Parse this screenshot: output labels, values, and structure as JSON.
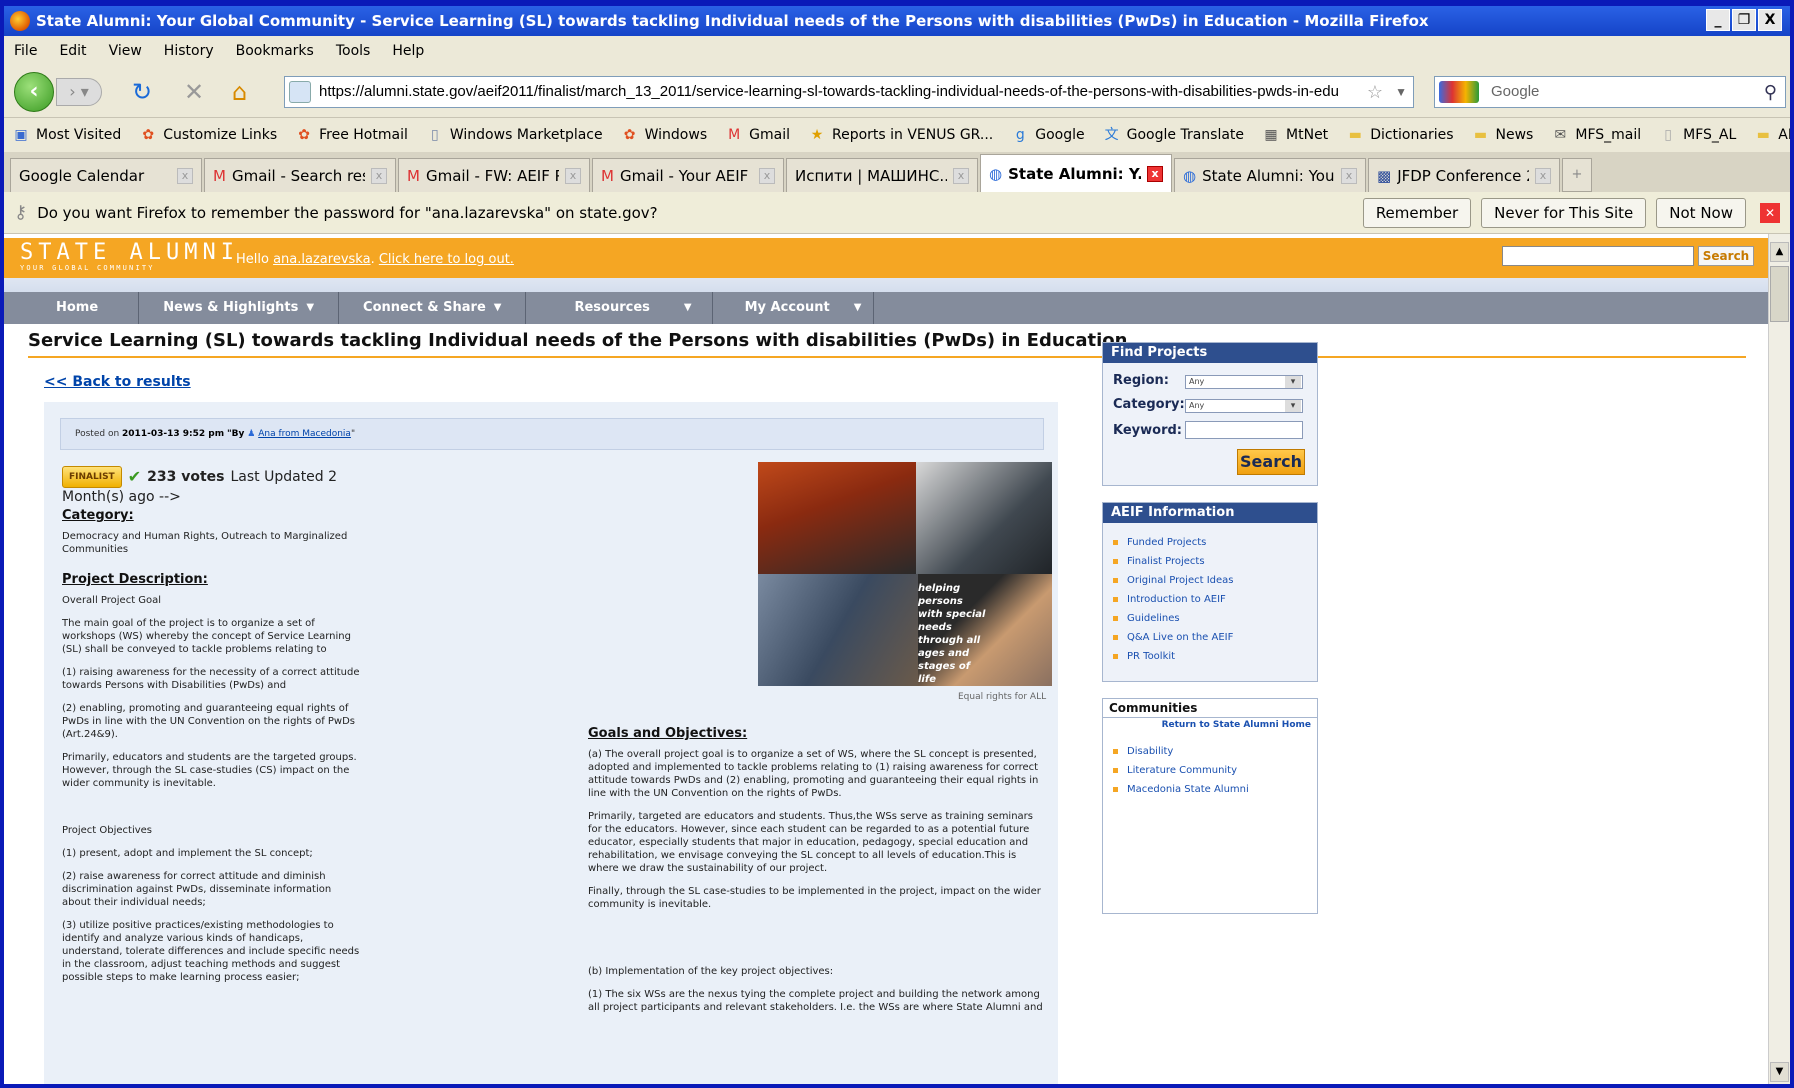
{
  "window": {
    "title": "State Alumni: Your Global Community - Service Learning (SL) towards tackling Individual needs of the Persons with disabilities (PwDs) in Education - Mozilla Firefox",
    "controls": [
      "_",
      "ő",
      "X"
    ]
  },
  "menu": [
    "File",
    "Edit",
    "View",
    "History",
    "Bookmarks",
    "Tools",
    "Help"
  ],
  "nav": {
    "url": "https://alumni.state.gov/aeif2011/finalist/march_13_2011/service-learning-sl-towards-tackling-individual-needs-of-the-persons-with-disabilities-pwds-in-edu",
    "search_placeholder": "Google"
  },
  "bookmarks": [
    "Most Visited",
    "Customize Links",
    "Free Hotmail",
    "Windows Marketplace",
    "Windows",
    "Gmail",
    "Reports in VENUS GR...",
    "Google",
    "Google Translate",
    "MtNet",
    "Dictionaries",
    "News",
    "MFS_mail",
    "MFS_AL",
    "ARM"
  ],
  "tabs": [
    {
      "label": "Google Calendar",
      "active": false
    },
    {
      "label": "Gmail - Search resu...",
      "active": false
    },
    {
      "label": "Gmail - FW: AEIF P...",
      "active": false
    },
    {
      "label": "Gmail - Your AEIF P...",
      "active": false
    },
    {
      "label": "Испити | МАШИНС...",
      "active": false
    },
    {
      "label": "State Alumni: Y...",
      "active": true
    },
    {
      "label": "State Alumni: Your ...",
      "active": false
    },
    {
      "label": "JFDP Conference 2...",
      "active": false
    }
  ],
  "password_bar": {
    "message": "Do you want Firefox to remember the password for \"ana.lazarevska\" on state.gov?",
    "remember": "Remember",
    "never": "Never for This Site",
    "not_now": "Not Now"
  },
  "site": {
    "logo_main": "STATE ALUMNI",
    "logo_sub": "YOUR GLOBAL COMMUNITY",
    "hello": "Hello",
    "username": "ana.lazarevska",
    "logout": "Click here to log out.",
    "search_btn": "Search",
    "nav": [
      "Home",
      "News & Highlights",
      "Connect & Share",
      "Resources",
      "My Account"
    ]
  },
  "page": {
    "title": "Service Learning (SL) towards tackling Individual needs of the Persons with disabilities (PwDs) in Education",
    "back": "<< Back to results",
    "posted_on": "Posted on",
    "posted_date": "2011-03-13 9:52 pm",
    "posted_by": "\"By",
    "author": "Ana from Macedonia",
    "posted_end": "\"",
    "finalist": "FINALIST",
    "votes": "233 votes",
    "updated": "Last Updated 2",
    "month": "Month(s) ago -->",
    "category_head": "Category:",
    "category": "Democracy and Human Rights, Outreach to Marginalized Communities",
    "desc_head": "Project Description:",
    "left_paras": [
      "Overall Project Goal",
      "The main goal of the project is to organize a set of workshops (WS) whereby the concept of Service Learning (SL) shall be conveyed to tackle problems relating to",
      "(1) raising awareness for the necessity of a correct attitude towards Persons with Disabilities (PwDs) and",
      "(2) enabling, promoting and guaranteeing equal rights of PwDs in line with the UN Convention on the rights of PwDs (Art.24&9).",
      "Primarily, educators and students are the targeted groups. However, through the SL case-studies (CS) impact on the wider community is inevitable.",
      "",
      "Project Objectives",
      "(1) present, adopt and implement the SL concept;",
      "(2) raise awareness for correct attitude and diminish discrimination against PwDs, disseminate information about their individual needs;",
      "(3) utilize positive practices/existing methodologies to identify and analyze various kinds of handicaps, understand, tolerate differences and include specific needs in the classroom, adjust teaching methods and suggest possible steps to make learning process easier;"
    ],
    "photo_caption_overlay": "helping persons with special needs through all ages and stages of life",
    "photo_caption": "Equal rights for ALL",
    "goals_head": "Goals and Objectives:",
    "right_paras": [
      "(a) The overall project goal is to organize a set of WS, where the SL concept is presented, adopted and implemented to tackle problems relating to (1) raising awareness for correct attitude towards PwDs and (2) enabling, promoting and guaranteeing their equal rights in line with the UN Convention on the rights of PwDs.",
      "Primarily, targeted are educators and students. Thus,the WSs serve as training seminars for the educators. However, since each student can be regarded to as a potential future educator, especially students that major in education, pedagogy, special education and rehabilitation, we envisage conveying the SL concept to all levels of education.This is where we draw the sustainability of our project.",
      "Finally, through the SL case-studies to be implemented in the project, impact on the wider community is inevitable.",
      "",
      "(b) Implementation of the key project objectives:",
      "(1) The six WSs are the nexus tying the complete project and building the network among all project participants and relevant stakeholders. I.e. the WSs are where State Alumni and"
    ]
  },
  "find_projects": {
    "title": "Find Projects",
    "region_label": "Region:",
    "region_value": "Any",
    "category_label": "Category:",
    "category_value": "Any",
    "keyword_label": "Keyword:",
    "search_btn": "Search"
  },
  "aeif_info": {
    "title": "AEIF Information",
    "items": [
      "Funded Projects",
      "Finalist Projects",
      "Original Project Ideas",
      "Introduction to AEIF",
      "Guidelines",
      "Q&A Live on the AEIF",
      "PR Toolkit"
    ]
  },
  "communities": {
    "title": "Communities",
    "return": "Return to State Alumni Home",
    "items": [
      "Disability",
      "Literature Community",
      "Macedonia State Alumni"
    ]
  }
}
